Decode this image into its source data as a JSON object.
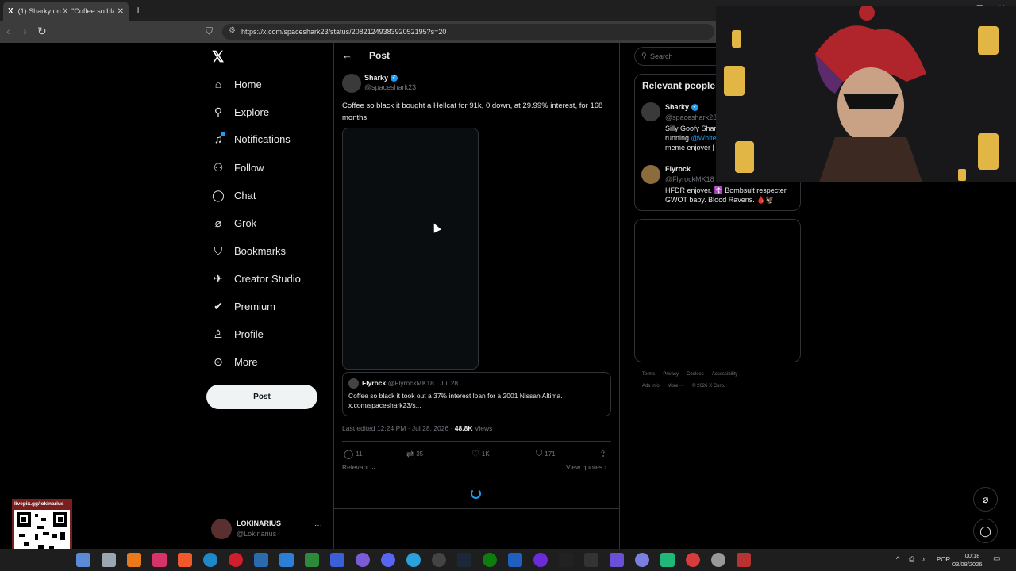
{
  "browser": {
    "tab_title": "(1) Sharky on X: \"Coffee so black",
    "tab_close": "✕",
    "new_tab": "+",
    "url": "https://x.com/spaceshark23/status/2082124938392052195?s=20"
  },
  "nav": {
    "items": [
      {
        "label": "Home",
        "icon": "⌂"
      },
      {
        "label": "Explore",
        "icon": "⚲"
      },
      {
        "label": "Notifications",
        "icon": "♫"
      },
      {
        "label": "Follow",
        "icon": "⚇"
      },
      {
        "label": "Chat",
        "icon": "◯"
      },
      {
        "label": "Grok",
        "icon": "⌀"
      },
      {
        "label": "Bookmarks",
        "icon": "⛉"
      },
      {
        "label": "Creator Studio",
        "icon": "✈"
      },
      {
        "label": "Premium",
        "icon": "✔"
      },
      {
        "label": "Profile",
        "icon": "♙"
      },
      {
        "label": "More",
        "icon": "⊙"
      }
    ],
    "post_label": "Post",
    "account": {
      "name": "LOKINARIUS",
      "handle": "@Lokinarius",
      "more": "···"
    }
  },
  "post": {
    "header_title": "Post",
    "author_name": "Sharky",
    "author_handle": "@spaceshark23",
    "text": "Coffee so black it bought a Hellcat for 91k, 0 down, at 29.99% interest, for 168 months.",
    "quote": {
      "author_name": "Flyrock",
      "author_handle": "@FlyrockMK18",
      "date": "· Jul 28",
      "text": "Coffee so black it took out a 37% interest loan for a 2001 Nissan Altima. x.com/spaceshark23/s..."
    },
    "meta_edited": "Last edited 12:24 PM · Jul 28, 2026 ·",
    "views_count": "48.8K",
    "views_label": "Views",
    "actions": {
      "replies": "11",
      "reposts": "35",
      "likes": "1K",
      "bookmarks": "171"
    },
    "sort_label": "Relevant",
    "view_quotes": "View quotes"
  },
  "sidebar": {
    "search_placeholder": "Search",
    "relevant_title": "Relevant people",
    "people": [
      {
        "name": "Sharky",
        "handle": "@spaceshark23",
        "bio_1": "Silly Goofy Shar",
        "bio_2_prefix": "running ",
        "bio_2_link": "@White",
        "bio_3": "meme enjoyer | D"
      },
      {
        "name": "Flyrock",
        "handle": "@FlyrockMK18",
        "bio_1": "HFDR enjoyer. ☦️ Bombsult respecter.",
        "bio_2": "GWOT baby. Blood Ravens. 🩸🦅"
      }
    ],
    "footer_row1": [
      "Terms",
      "Privacy",
      "Cookies",
      "Accessibility"
    ],
    "footer_row2": [
      "Ads info",
      "More ···",
      "© 2026 X Corp."
    ]
  },
  "overlay": {
    "qr_label": "livepix.gg/lokinarius"
  },
  "taskbar": {
    "lang": "POR",
    "time": "00:18",
    "date": "03/08/2026"
  }
}
